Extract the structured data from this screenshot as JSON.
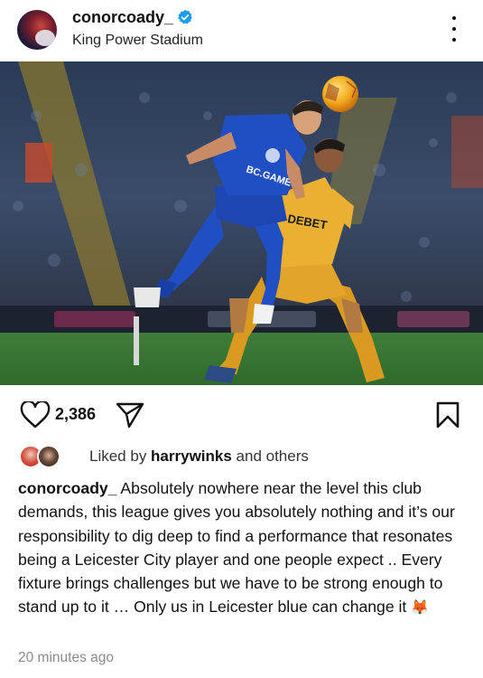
{
  "post": {
    "username": "conorcoady_",
    "location": "King Power Stadium",
    "verified": true,
    "like_count": "2,386",
    "liked_by_prefix": "Liked by ",
    "liked_by_user": "harrywinks",
    "liked_by_suffix": " and others",
    "caption_user": "conorcoady_",
    "caption_text": " Absolutely nowhere near the level this club demands, this league gives you absolutely nothing and it’s our responsibility to dig deep to find a performance that resonates being a Leicester City player and one people expect .. Every fixture brings challenges but we have to be strong enough to stand up to it … Only us in Leicester blue can change it ",
    "caption_emoji": "🦊",
    "timestamp": "20 minutes ago"
  },
  "photo": {
    "shirt_sponsor_left": "BC.GAME",
    "shirt_sponsor_right": "DEBET"
  },
  "icons": {
    "verified": "verified-badge-icon",
    "more": "more-options-icon",
    "like": "heart-icon",
    "share": "send-icon",
    "save": "bookmark-icon"
  },
  "colors": {
    "verified_blue": "#1d9bf0",
    "leicester_blue": "#1f4fc2",
    "wolves_gold": "#e6a92c"
  }
}
